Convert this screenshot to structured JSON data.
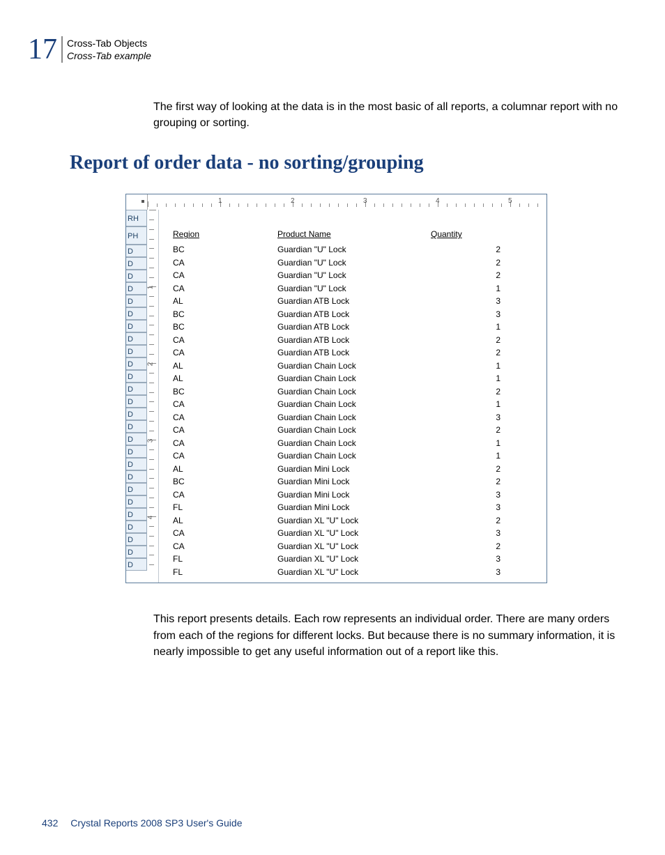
{
  "header": {
    "chapter_number": "17",
    "title": "Cross-Tab Objects",
    "subtitle": "Cross-Tab example"
  },
  "intro_paragraph": "The first way of looking at the data is in the most basic of all reports, a columnar report with no grouping or sorting.",
  "section_heading": "Report of order data - no sorting/grouping",
  "report": {
    "ruler_majors": [
      "1",
      "2",
      "3",
      "4",
      "5"
    ],
    "sections": {
      "rh": "RH",
      "ph": "PH",
      "d": "D"
    },
    "vruler_nums": [
      "1",
      "2",
      "3",
      "4"
    ],
    "columns": {
      "region": "Region",
      "product": "Product Name",
      "quantity": "Quantity"
    },
    "rows": [
      {
        "region": "BC",
        "product": "Guardian \"U\" Lock",
        "qty": "2"
      },
      {
        "region": "CA",
        "product": "Guardian \"U\" Lock",
        "qty": "2"
      },
      {
        "region": "CA",
        "product": "Guardian \"U\" Lock",
        "qty": "2"
      },
      {
        "region": "CA",
        "product": "Guardian \"U\" Lock",
        "qty": "1"
      },
      {
        "region": "AL",
        "product": "Guardian ATB Lock",
        "qty": "3"
      },
      {
        "region": "BC",
        "product": "Guardian ATB Lock",
        "qty": "3"
      },
      {
        "region": "BC",
        "product": "Guardian ATB Lock",
        "qty": "1"
      },
      {
        "region": "CA",
        "product": "Guardian ATB Lock",
        "qty": "2"
      },
      {
        "region": "CA",
        "product": "Guardian ATB Lock",
        "qty": "2"
      },
      {
        "region": "AL",
        "product": "Guardian Chain Lock",
        "qty": "1"
      },
      {
        "region": "AL",
        "product": "Guardian Chain Lock",
        "qty": "1"
      },
      {
        "region": "BC",
        "product": "Guardian Chain Lock",
        "qty": "2"
      },
      {
        "region": "CA",
        "product": "Guardian Chain Lock",
        "qty": "1"
      },
      {
        "region": "CA",
        "product": "Guardian Chain Lock",
        "qty": "3"
      },
      {
        "region": "CA",
        "product": "Guardian Chain Lock",
        "qty": "2"
      },
      {
        "region": "CA",
        "product": "Guardian Chain Lock",
        "qty": "1"
      },
      {
        "region": "CA",
        "product": "Guardian Chain Lock",
        "qty": "1"
      },
      {
        "region": "AL",
        "product": "Guardian Mini Lock",
        "qty": "2"
      },
      {
        "region": "BC",
        "product": "Guardian Mini Lock",
        "qty": "2"
      },
      {
        "region": "CA",
        "product": "Guardian Mini Lock",
        "qty": "3"
      },
      {
        "region": "FL",
        "product": "Guardian Mini Lock",
        "qty": "3"
      },
      {
        "region": "AL",
        "product": "Guardian XL \"U\" Lock",
        "qty": "2"
      },
      {
        "region": "CA",
        "product": "Guardian XL \"U\" Lock",
        "qty": "3"
      },
      {
        "region": "CA",
        "product": "Guardian XL \"U\" Lock",
        "qty": "2"
      },
      {
        "region": "FL",
        "product": "Guardian XL \"U\" Lock",
        "qty": "3"
      },
      {
        "region": "FL",
        "product": "Guardian XL \"U\" Lock",
        "qty": "3"
      }
    ]
  },
  "after_paragraph": "This report presents details. Each row represents an individual order. There are many orders from each of the regions for different locks. But because there is no summary information, it is nearly impossible to get any useful information out of a report like this.",
  "footer": {
    "page_number": "432",
    "doc_title": "Crystal Reports 2008 SP3 User's Guide"
  }
}
